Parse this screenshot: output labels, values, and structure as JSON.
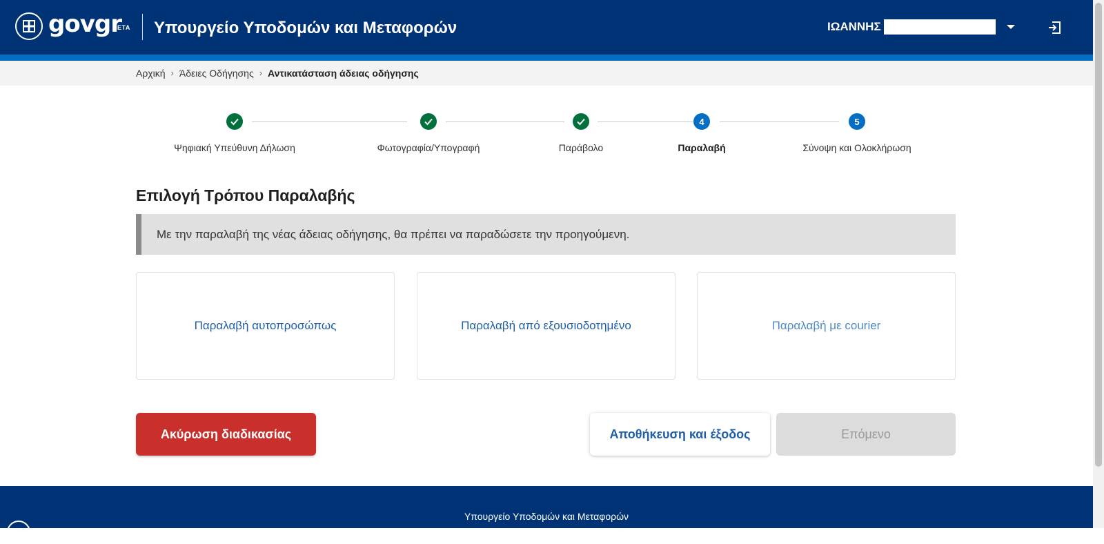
{
  "header": {
    "logo_text": "gov",
    "logo_text_accent": "gr",
    "logo_badge": "BETA",
    "ministry": "Υπουργείο Υποδομών και Μεταφορών",
    "user_name": "ΙΩΑΝΝΗΣ",
    "colors": {
      "bar": "#003375",
      "accent": "#046ec5"
    }
  },
  "breadcrumb": {
    "items": [
      "Αρχική",
      "Άδειες Οδήγησης"
    ],
    "current": "Αντικατάσταση άδειας οδήγησης"
  },
  "stepper": {
    "steps": [
      {
        "label": "Ψηφιακή Υπεύθυνη Δήλωση",
        "status": "done",
        "icon": "check-icon"
      },
      {
        "label": "Φωτογραφία/Υπογραφή",
        "status": "done",
        "icon": "check-icon"
      },
      {
        "label": "Παράβολο",
        "status": "done",
        "icon": "check-icon"
      },
      {
        "label": "Παραλαβή",
        "status": "active",
        "number": "4"
      },
      {
        "label": "Σύνοψη και Ολοκλήρωση",
        "status": "pending",
        "number": "5"
      }
    ]
  },
  "main": {
    "title": "Επιλογή Τρόπου Παραλαβής",
    "notice": "Με την παραλαβή της νέας άδειας οδήγησης, θα πρέπει να παραδώσετε την προηγούμενη.",
    "options": [
      {
        "label": "Παραλαβή αυτοπροσώπως"
      },
      {
        "label": "Παραλαβή από εξουσιοδοτημένο"
      },
      {
        "label": "Παραλαβή με courier"
      }
    ]
  },
  "actions": {
    "cancel": "Ακύρωση διαδικασίας",
    "save_exit": "Αποθήκευση και έξοδος",
    "next": "Επόμενο",
    "colors": {
      "cancel": "#c9302c",
      "link": "#1f5fa8",
      "disabled": "#dcdcdc"
    }
  },
  "footer": {
    "ministry": "Υπουργείο Υποδομών και Μεταφορών"
  }
}
